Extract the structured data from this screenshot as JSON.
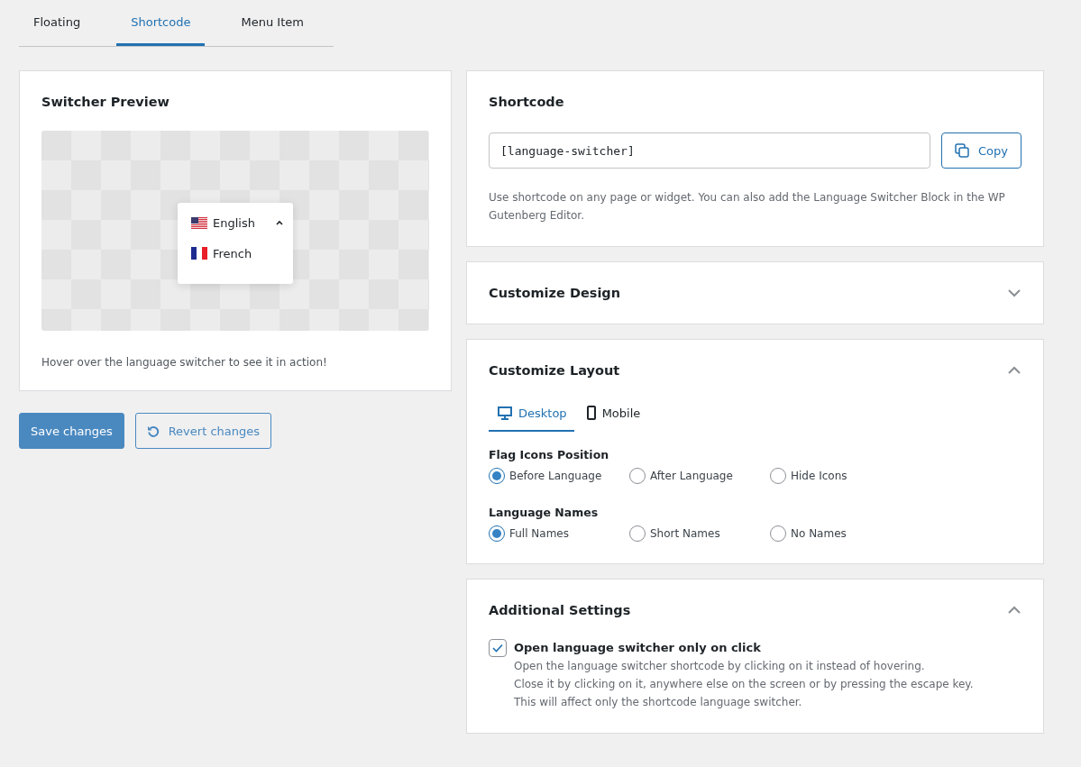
{
  "tabs": [
    {
      "label": "Floating",
      "selected": false
    },
    {
      "label": "Shortcode",
      "selected": true
    },
    {
      "label": "Menu Item",
      "selected": false
    }
  ],
  "preview": {
    "title": "Switcher Preview",
    "switcher": {
      "expanded": true,
      "languages": [
        {
          "kind": "us",
          "name": "English"
        },
        {
          "kind": "fr",
          "name": "French"
        }
      ]
    },
    "hint": "Hover over the language switcher to see it in action!"
  },
  "actions": {
    "save": "Save changes",
    "revert": "Revert changes"
  },
  "shortcode": {
    "title": "Shortcode",
    "value": "[language-switcher]",
    "copy": "Copy",
    "help": "Use shortcode on any page or widget. You can also add the Language Switcher Block in the WP Gutenberg Editor."
  },
  "design": {
    "title": "Customize Design",
    "expanded": false
  },
  "layout": {
    "title": "Customize Layout",
    "expanded": true,
    "devices": [
      {
        "kind": "desktop",
        "label": "Desktop",
        "selected": true
      },
      {
        "kind": "mobile",
        "label": "Mobile",
        "selected": false
      }
    ],
    "groups": [
      {
        "label": "Flag Icons Position",
        "options": [
          {
            "label": "Before Language",
            "selected": true
          },
          {
            "label": "After Language",
            "selected": false
          },
          {
            "label": "Hide Icons",
            "selected": false
          }
        ]
      },
      {
        "label": "Language Names",
        "options": [
          {
            "label": "Full Names",
            "selected": true
          },
          {
            "label": "Short Names",
            "selected": false
          },
          {
            "label": "No Names",
            "selected": false
          }
        ]
      }
    ]
  },
  "additional": {
    "title": "Additional Settings",
    "expanded": true,
    "option": {
      "label": "Open language switcher only on click",
      "checked": true,
      "description": [
        "Open the language switcher shortcode by clicking on it instead of hovering.",
        "Close it by clicking on it, anywhere else on the screen or by pressing the escape key.",
        "This will affect only the shortcode language switcher."
      ]
    }
  }
}
